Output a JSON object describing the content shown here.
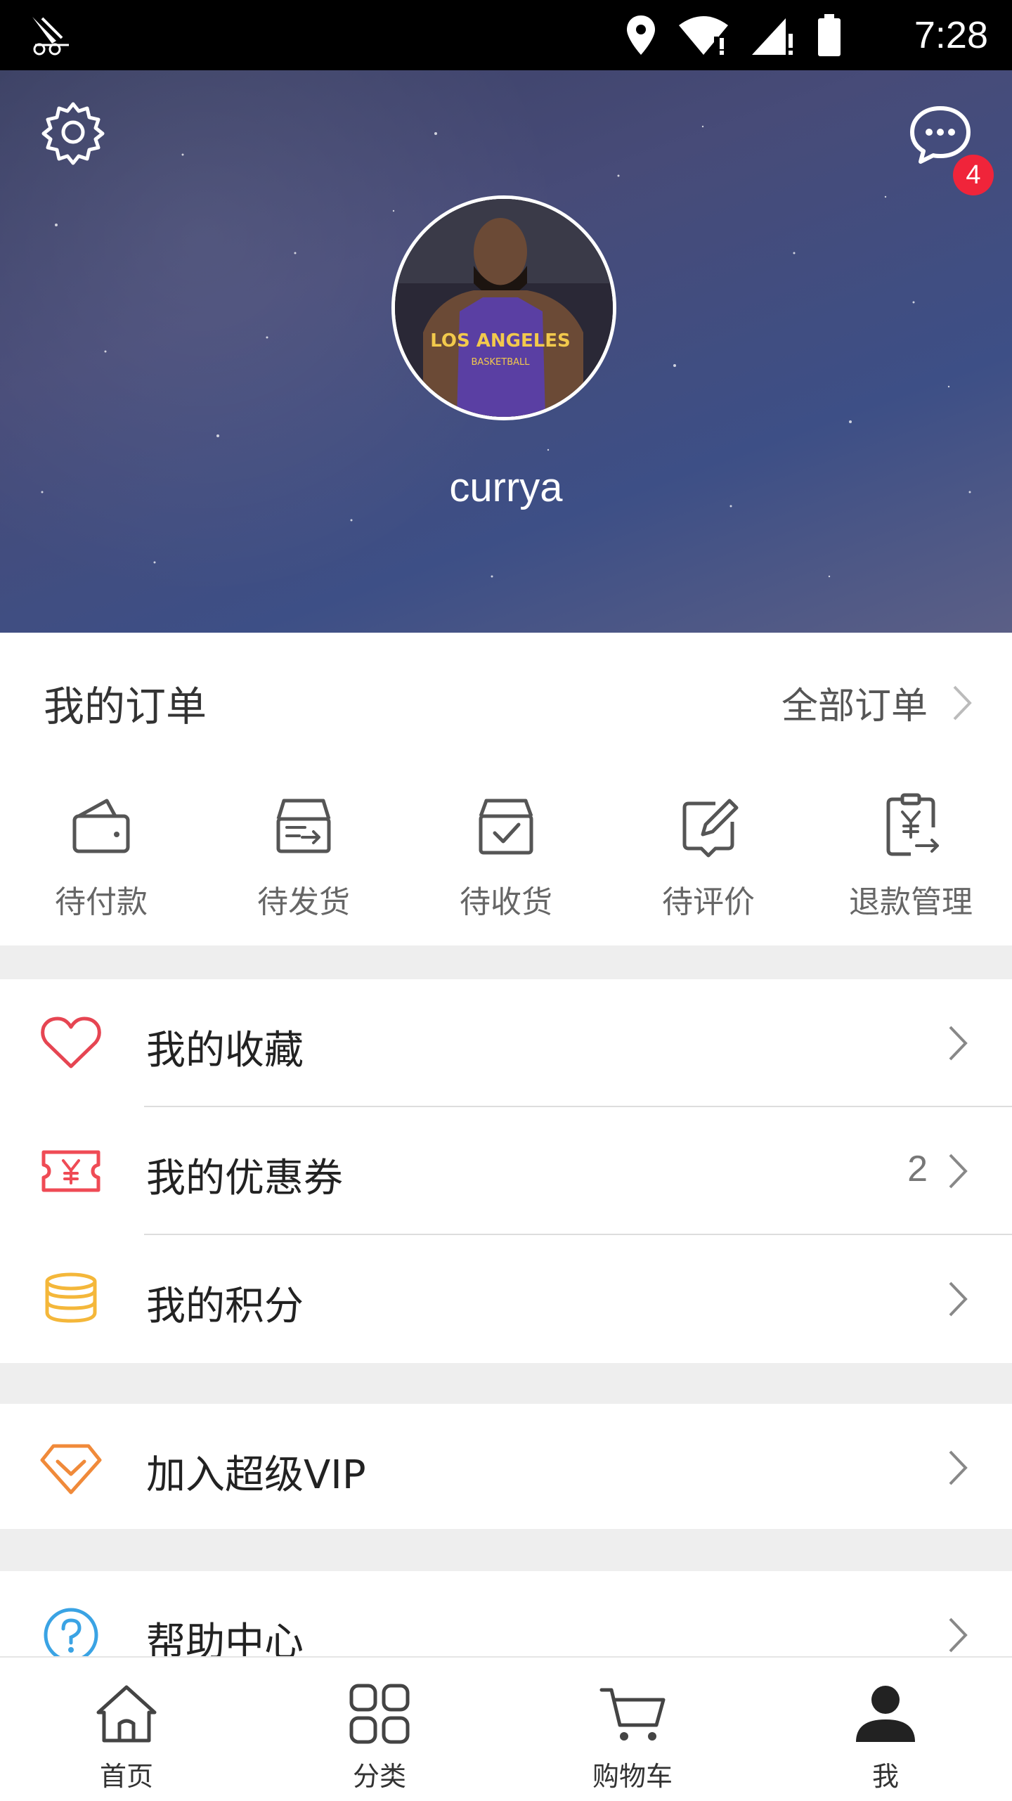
{
  "status_bar": {
    "time": "7:28"
  },
  "profile": {
    "username": "currya",
    "message_badge": "4"
  },
  "orders": {
    "title": "我的订单",
    "all_orders_label": "全部订单",
    "tabs": [
      {
        "label": "待付款",
        "icon": "wallet-icon"
      },
      {
        "label": "待发货",
        "icon": "box-icon"
      },
      {
        "label": "待收货",
        "icon": "box-check-icon"
      },
      {
        "label": "待评价",
        "icon": "edit-icon"
      },
      {
        "label": "退款管理",
        "icon": "refund-icon"
      }
    ]
  },
  "menu": {
    "items": [
      {
        "label": "我的收藏",
        "value": "",
        "icon": "heart-icon"
      },
      {
        "label": "我的优惠券",
        "value": "2",
        "icon": "coupon-icon"
      },
      {
        "label": "我的积分",
        "value": "",
        "icon": "coins-icon"
      },
      {
        "label": "加入超级VIP",
        "value": "",
        "icon": "diamond-icon"
      },
      {
        "label": "帮助中心",
        "value": "",
        "icon": "help-icon"
      }
    ]
  },
  "bottom_nav": {
    "items": [
      {
        "label": "首页",
        "icon": "home-icon"
      },
      {
        "label": "分类",
        "icon": "grid-icon"
      },
      {
        "label": "购物车",
        "icon": "cart-icon"
      },
      {
        "label": "我",
        "icon": "profile-icon",
        "active": true
      }
    ]
  },
  "colors": {
    "accent_red": "#f0243a",
    "heart_red": "#e64552",
    "coupon_red": "#ef4b55",
    "coin_yellow": "#f4b73a",
    "vip_orange": "#f08a3a",
    "help_blue": "#3aa3e4",
    "page_gray": "#eeeeee"
  }
}
